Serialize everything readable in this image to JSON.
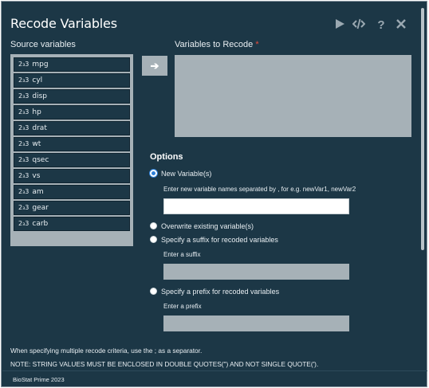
{
  "window": {
    "title": "Recode Variables"
  },
  "toolbar": {
    "icons": [
      "play-icon",
      "code-icon",
      "help-icon",
      "close-icon"
    ]
  },
  "source": {
    "label": "Source variables",
    "type_icon": "2₃3",
    "items": [
      "mpg",
      "cyl",
      "disp",
      "hp",
      "drat",
      "wt",
      "qsec",
      "vs",
      "am",
      "gear",
      "carb"
    ]
  },
  "move_button": {
    "label": "➔"
  },
  "target": {
    "label": "Variables to Recode",
    "required_mark": "*"
  },
  "options": {
    "title": "Options",
    "new_variable": {
      "label": "New Variable(s)",
      "checked": true,
      "hint": "Enter new variable names separated by , for e.g. newVar1, newVar2",
      "value": ""
    },
    "overwrite": {
      "label": "Overwrite existing variable(s)",
      "checked": false
    },
    "suffix": {
      "label": "Specify a suffix for recoded variables",
      "checked": false,
      "hint": "Enter a suffix",
      "value": ""
    },
    "prefix": {
      "label": "Specify a prefix for recoded variables",
      "checked": false,
      "hint": "Enter a prefix",
      "value": ""
    }
  },
  "notes": {
    "separator": "When specifying multiple recode criteria, use the ; as a separator.",
    "quotes": "NOTE: STRING VALUES MUST BE ENCLOSED IN DOUBLE QUOTES(\") AND NOT SINGLE QUOTE(')."
  },
  "footer": {
    "text": "BioStat Prime 2023"
  },
  "colors": {
    "background": "#1c3746",
    "panel": "#a6b1b7",
    "radio_accent": "#2f80d8",
    "required": "#e74c3c"
  }
}
